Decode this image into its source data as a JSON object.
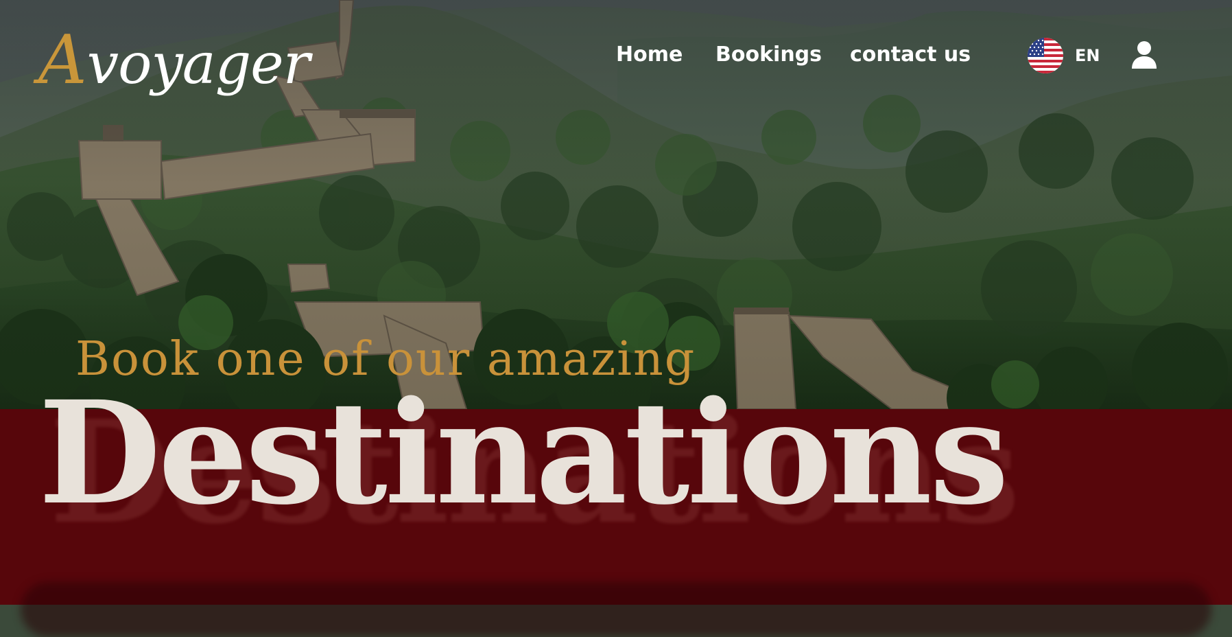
{
  "header": {
    "logo": {
      "initial": "A",
      "rest": "voyager"
    },
    "nav": [
      {
        "label": "Home"
      },
      {
        "label": "Bookings"
      },
      {
        "label": "contact us"
      }
    ],
    "language": {
      "code": "EN",
      "flag_icon": "us-flag-icon"
    },
    "user_icon": "user-icon"
  },
  "hero": {
    "tagline": "Book one of our amazing",
    "headline": "Destinations"
  },
  "colors": {
    "accent_gold": "#c9963a",
    "band_red": "#57060b",
    "headline_text": "#e8e2da",
    "nav_text": "#ffffff"
  }
}
